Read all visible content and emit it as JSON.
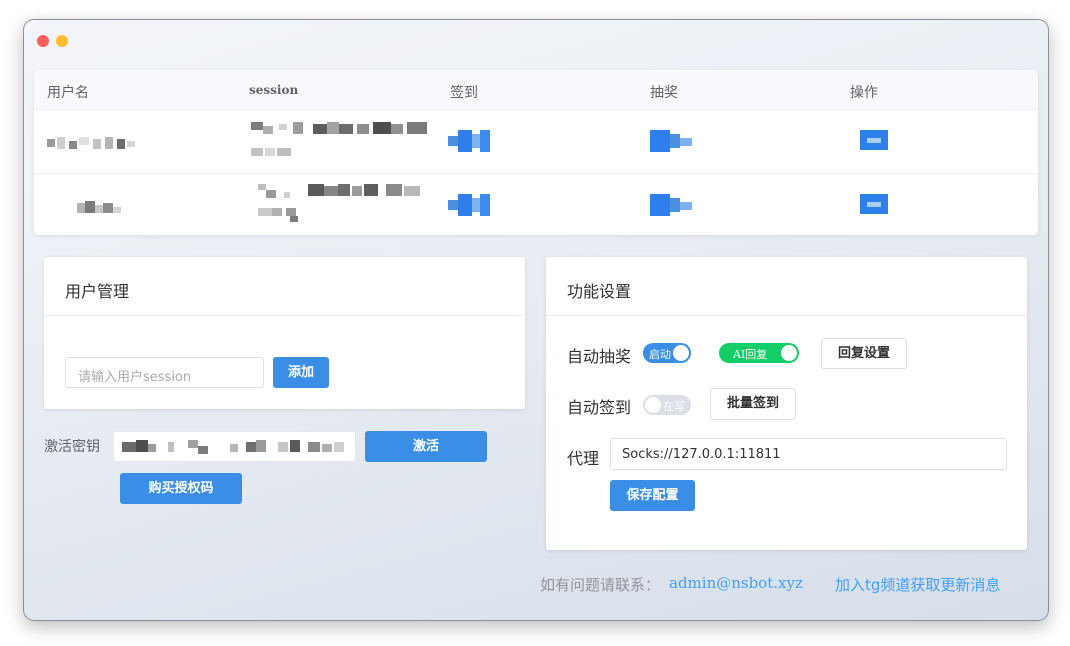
{
  "window": {
    "close_color": "#ff5f57",
    "minimize_color": "#febc2e"
  },
  "table": {
    "headers": {
      "username": "用户名",
      "session": "session",
      "checkin": "签到",
      "lottery": "抽奖",
      "action": "操作"
    },
    "rows": [
      {
        "username": "(blurred)",
        "session": "(blurred)"
      },
      {
        "username": "(blurred)",
        "session": "(blurred)"
      }
    ]
  },
  "user_mgmt": {
    "title": "用户管理",
    "session_placeholder": "请输入用户session",
    "add_label": "添加",
    "activation_label": "激活密钥",
    "activate_label": "激活",
    "buy_label": "购买授权码"
  },
  "features": {
    "title": "功能设置",
    "auto_lottery_label": "自动抽奖",
    "auto_lottery_switch_text": "启动",
    "ai_reply_switch_text": "AI回复",
    "reply_settings_label": "回复设置",
    "auto_checkin_label": "自动签到",
    "auto_checkin_switch_text": "在写",
    "batch_checkin_label": "批量签到",
    "proxy_label": "代理",
    "proxy_value": "Socks://127.0.0.1:11811",
    "save_label": "保存配置"
  },
  "footer": {
    "contact_prefix": "如有问题请联系：",
    "contact_email": "admin@nsbot.xyz",
    "tg_link": "加入tg频道获取更新消息"
  },
  "colors": {
    "primary": "#3a8ee6",
    "switch_on_blue": "#3a8ee6",
    "switch_on_green": "#13ce66",
    "switch_off": "#dcdfe6",
    "link": "#409eff"
  }
}
